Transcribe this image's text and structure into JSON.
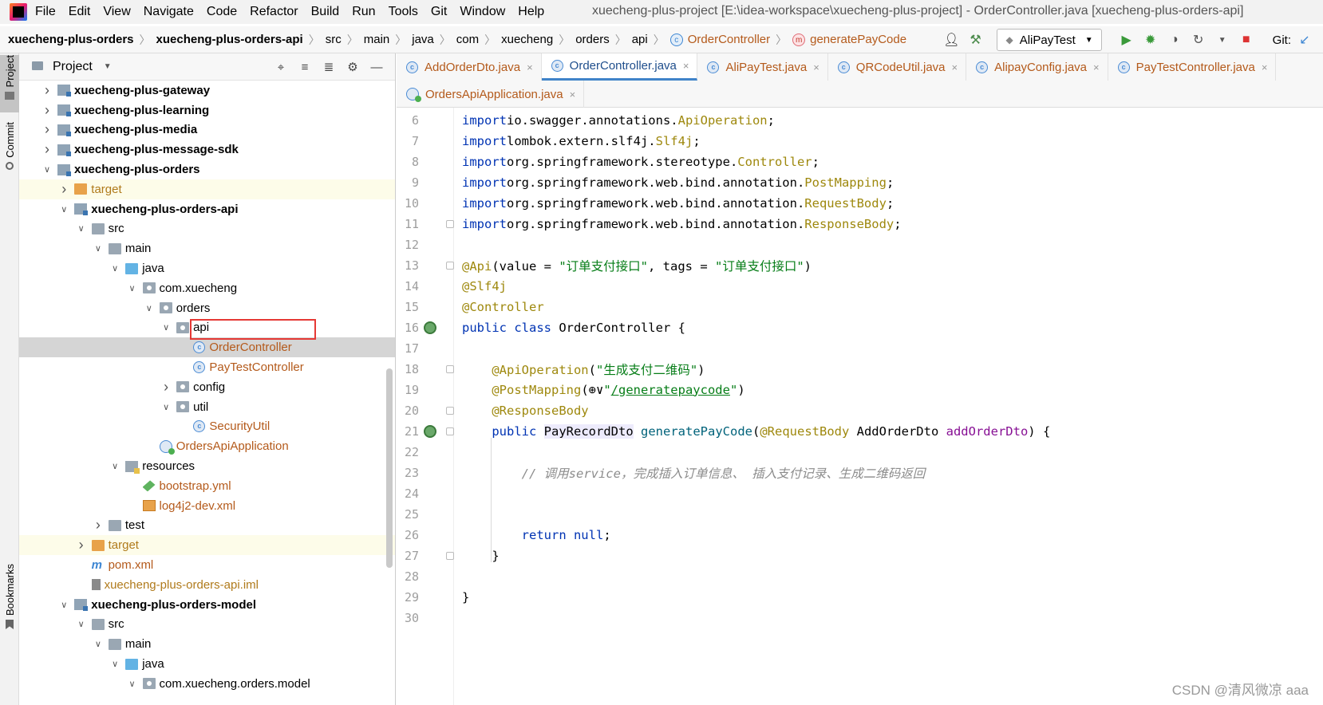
{
  "menubar": {
    "items": [
      "File",
      "Edit",
      "View",
      "Navigate",
      "Code",
      "Refactor",
      "Build",
      "Run",
      "Tools",
      "Git",
      "Window",
      "Help"
    ],
    "window_title": "xuecheng-plus-project [E:\\idea-workspace\\xuecheng-plus-project] - OrderController.java [xuecheng-plus-orders-api]"
  },
  "navbar": {
    "crumbs": [
      "xuecheng-plus-orders",
      "xuecheng-plus-orders-api",
      "src",
      "main",
      "java",
      "com",
      "xuecheng",
      "orders",
      "api",
      "OrderController",
      "generatePayCode"
    ],
    "run_config": "AliPayTest",
    "git_label": "Git:"
  },
  "leftstrip": {
    "project_tab": "Project",
    "commit_tab": "Commit",
    "bookmarks_tab": "Bookmarks"
  },
  "project_panel": {
    "title": "Project",
    "tree": [
      {
        "label": "xuecheng-plus-gateway",
        "icon": "module-icon",
        "depth": 0,
        "arrow": "collapsed",
        "style": "bold"
      },
      {
        "label": "xuecheng-plus-learning",
        "icon": "module-icon",
        "depth": 0,
        "arrow": "collapsed",
        "style": "bold"
      },
      {
        "label": "xuecheng-plus-media",
        "icon": "module-icon",
        "depth": 0,
        "arrow": "collapsed",
        "style": "bold"
      },
      {
        "label": "xuecheng-plus-message-sdk",
        "icon": "module-icon",
        "depth": 0,
        "arrow": "collapsed",
        "style": "bold"
      },
      {
        "label": "xuecheng-plus-orders",
        "icon": "module-icon",
        "depth": 0,
        "arrow": "expanded",
        "style": "bold"
      },
      {
        "label": "target",
        "icon": "folder-orange-icon",
        "depth": 1,
        "arrow": "collapsed",
        "style": "excluded"
      },
      {
        "label": "xuecheng-plus-orders-api",
        "icon": "module-icon",
        "depth": 1,
        "arrow": "expanded",
        "style": "bold"
      },
      {
        "label": "src",
        "icon": "folder-icon",
        "depth": 2,
        "arrow": "expanded",
        "style": ""
      },
      {
        "label": "main",
        "icon": "folder-icon",
        "depth": 3,
        "arrow": "expanded",
        "style": ""
      },
      {
        "label": "java",
        "icon": "folder-blue-icon",
        "depth": 4,
        "arrow": "expanded",
        "style": ""
      },
      {
        "label": "com.xuecheng",
        "icon": "package-icon",
        "depth": 5,
        "arrow": "expanded",
        "style": ""
      },
      {
        "label": "orders",
        "icon": "package-icon",
        "depth": 6,
        "arrow": "expanded",
        "style": ""
      },
      {
        "label": "api",
        "icon": "package-icon",
        "depth": 7,
        "arrow": "expanded",
        "style": ""
      },
      {
        "label": "OrderController",
        "icon": "class-icon",
        "depth": 8,
        "arrow": "none",
        "style": "orange",
        "selected": true
      },
      {
        "label": "PayTestController",
        "icon": "class-icon",
        "depth": 8,
        "arrow": "none",
        "style": "orange"
      },
      {
        "label": "config",
        "icon": "package-icon",
        "depth": 7,
        "arrow": "collapsed",
        "style": ""
      },
      {
        "label": "util",
        "icon": "package-icon",
        "depth": 7,
        "arrow": "expanded",
        "style": ""
      },
      {
        "label": "SecurityUtil",
        "icon": "class-icon",
        "depth": 8,
        "arrow": "none",
        "style": "orange"
      },
      {
        "label": "OrdersApiApplication",
        "icon": "spring-app-icon",
        "depth": 6,
        "arrow": "none",
        "style": "orange"
      },
      {
        "label": "resources",
        "icon": "resources-folder-icon",
        "depth": 4,
        "arrow": "expanded",
        "style": ""
      },
      {
        "label": "bootstrap.yml",
        "icon": "yml-file-icon",
        "depth": 5,
        "arrow": "none",
        "style": "orange"
      },
      {
        "label": "log4j2-dev.xml",
        "icon": "xml-file-icon",
        "depth": 5,
        "arrow": "none",
        "style": "orange"
      },
      {
        "label": "test",
        "icon": "folder-icon",
        "depth": 3,
        "arrow": "collapsed",
        "style": ""
      },
      {
        "label": "target",
        "icon": "folder-orange-icon",
        "depth": 2,
        "arrow": "collapsed",
        "style": "excluded"
      },
      {
        "label": "pom.xml",
        "icon": "maven-pom-icon",
        "depth": 2,
        "arrow": "none",
        "style": "orange"
      },
      {
        "label": "xuecheng-plus-orders-api.iml",
        "icon": "iml-file-icon",
        "depth": 2,
        "arrow": "none",
        "style": "excluded"
      },
      {
        "label": "xuecheng-plus-orders-model",
        "icon": "module-icon",
        "depth": 1,
        "arrow": "expanded",
        "style": "bold"
      },
      {
        "label": "src",
        "icon": "folder-icon",
        "depth": 2,
        "arrow": "expanded",
        "style": ""
      },
      {
        "label": "main",
        "icon": "folder-icon",
        "depth": 3,
        "arrow": "expanded",
        "style": ""
      },
      {
        "label": "java",
        "icon": "folder-blue-icon",
        "depth": 4,
        "arrow": "expanded",
        "style": ""
      },
      {
        "label": "com.xuecheng.orders.model",
        "icon": "package-icon",
        "depth": 5,
        "arrow": "expanded",
        "style": ""
      }
    ]
  },
  "editor_tabs": {
    "row1": [
      {
        "label": "AddOrderDto.java",
        "icon": "class-icon",
        "active": false
      },
      {
        "label": "OrderController.java",
        "icon": "class-icon",
        "active": true
      },
      {
        "label": "AliPayTest.java",
        "icon": "test-class-icon",
        "active": false
      },
      {
        "label": "QRCodeUtil.java",
        "icon": "class-icon",
        "active": false
      },
      {
        "label": "AlipayConfig.java",
        "icon": "class-icon",
        "active": false
      },
      {
        "label": "PayTestController.java",
        "icon": "class-icon",
        "active": false
      }
    ],
    "row2": [
      {
        "label": "OrdersApiApplication.java",
        "icon": "spring-app-icon",
        "active": false
      }
    ]
  },
  "editor": {
    "lines": [
      {
        "n": "6",
        "tokens": [
          [
            "kw",
            "import"
          ],
          [
            "",
            "io.swagger.annotations."
          ],
          [
            "ann",
            "ApiOperation"
          ],
          [
            "",
            ";"
          ]
        ]
      },
      {
        "n": "7",
        "tokens": [
          [
            "kw",
            "import"
          ],
          [
            "",
            "lombok.extern.slf4j."
          ],
          [
            "ann",
            "Slf4j"
          ],
          [
            "",
            ";"
          ]
        ]
      },
      {
        "n": "8",
        "tokens": [
          [
            "kw",
            "import"
          ],
          [
            "",
            "org.springframework.stereotype."
          ],
          [
            "ann",
            "Controller"
          ],
          [
            "",
            ";"
          ]
        ]
      },
      {
        "n": "9",
        "tokens": [
          [
            "kw",
            "import"
          ],
          [
            "",
            "org.springframework.web.bind.annotation."
          ],
          [
            "ann",
            "PostMapping"
          ],
          [
            "",
            ";"
          ]
        ]
      },
      {
        "n": "10",
        "tokens": [
          [
            "kw",
            "import"
          ],
          [
            "",
            "org.springframework.web.bind.annotation."
          ],
          [
            "ann",
            "RequestBody"
          ],
          [
            "",
            ";"
          ]
        ]
      },
      {
        "n": "11",
        "tokens": [
          [
            "kw",
            "import"
          ],
          [
            "",
            "org.springframework.web.bind.annotation."
          ],
          [
            "ann",
            "ResponseBody"
          ],
          [
            "",
            ";"
          ]
        ]
      },
      {
        "n": "12",
        "tokens": []
      },
      {
        "n": "13",
        "tokens": [
          [
            "ann",
            "@Api"
          ],
          [
            "",
            "(value = "
          ],
          [
            "str",
            "\"订单支付接口\""
          ],
          [
            "",
            ", tags = "
          ],
          [
            "str",
            "\"订单支付接口\""
          ],
          [
            "",
            ")"
          ]
        ]
      },
      {
        "n": "14",
        "tokens": [
          [
            "ann",
            "@Slf4j"
          ]
        ]
      },
      {
        "n": "15",
        "tokens": [
          [
            "ann",
            "@Controller"
          ]
        ]
      },
      {
        "n": "16",
        "tokens": [
          [
            "kw",
            "public class"
          ],
          [
            "",
            " OrderController {"
          ]
        ]
      },
      {
        "n": "17",
        "tokens": []
      },
      {
        "n": "18",
        "tokens": [
          [
            "",
            "    "
          ],
          [
            "ann",
            "@ApiOperation"
          ],
          [
            "",
            "("
          ],
          [
            "str",
            "\"生成支付二维码\""
          ],
          [
            "",
            ")"
          ]
        ]
      },
      {
        "n": "19",
        "tokens": [
          [
            "",
            "    "
          ],
          [
            "ann",
            "@PostMapping"
          ],
          [
            "",
            "(⊕∨"
          ],
          [
            "str",
            "\""
          ],
          [
            "urlref",
            "/generatepaycode"
          ],
          [
            "str",
            "\""
          ],
          [
            "",
            ")"
          ]
        ]
      },
      {
        "n": "20",
        "tokens": [
          [
            "",
            "    "
          ],
          [
            "ann",
            "@ResponseBody"
          ]
        ]
      },
      {
        "n": "21",
        "tokens": [
          [
            "",
            "    "
          ],
          [
            "kw",
            "public"
          ],
          [
            "",
            " "
          ],
          [
            "hl",
            "PayRecordDto"
          ],
          [
            "",
            " "
          ],
          [
            "method",
            "generatePayCode"
          ],
          [
            "",
            "("
          ],
          [
            "ann",
            "@RequestBody"
          ],
          [
            "",
            " AddOrderDto "
          ],
          [
            "param",
            "addOrderDto"
          ],
          [
            "",
            ") {"
          ]
        ]
      },
      {
        "n": "22",
        "tokens": []
      },
      {
        "n": "23",
        "tokens": [
          [
            "",
            "        "
          ],
          [
            "cmt",
            "// 调用service，完成插入订单信息、 插入支付记录、生成二维码返回"
          ]
        ]
      },
      {
        "n": "24",
        "tokens": []
      },
      {
        "n": "25",
        "tokens": []
      },
      {
        "n": "26",
        "tokens": [
          [
            "",
            "        "
          ],
          [
            "kw",
            "return null"
          ],
          [
            "",
            ";"
          ]
        ]
      },
      {
        "n": "27",
        "tokens": [
          [
            "",
            "    }"
          ]
        ]
      },
      {
        "n": "28",
        "tokens": []
      },
      {
        "n": "29",
        "tokens": [
          [
            "",
            "}"
          ]
        ]
      },
      {
        "n": "30",
        "tokens": []
      }
    ],
    "gutter_icons": {
      "16": "spring-bean-icon",
      "21": "spring-bean-icon"
    },
    "fold_markers": [
      "11",
      "13",
      "18",
      "20",
      "21",
      "27"
    ]
  },
  "watermark": "CSDN @清风微凉 aaa",
  "colors": {
    "keyword": "#0033b3",
    "annotation": "#9e880d",
    "string": "#067d17",
    "comment": "#8c8c8c",
    "highlight_box": "#e53935",
    "active_tab_underline": "#4083c9"
  }
}
